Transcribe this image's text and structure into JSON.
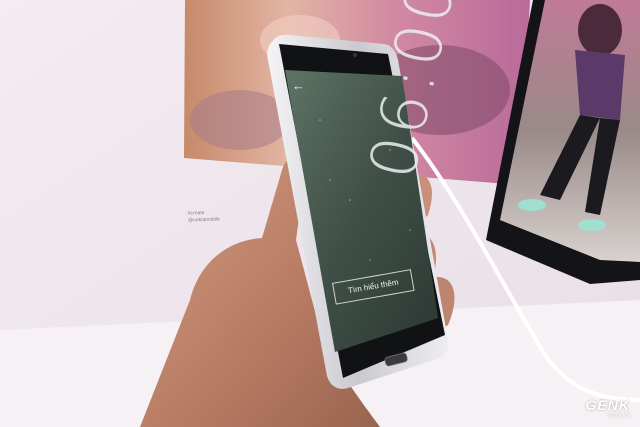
{
  "phone_screen": {
    "back_icon": "arrow-left-icon",
    "clock_time": "06:00",
    "button_label": "Tìm hiểu thêm"
  },
  "poster": {
    "caption_line1": "#create",
    "caption_line2": "@nokiamobile"
  },
  "watermark": {
    "brand": "GENK",
    "site": "GENK.VN"
  }
}
